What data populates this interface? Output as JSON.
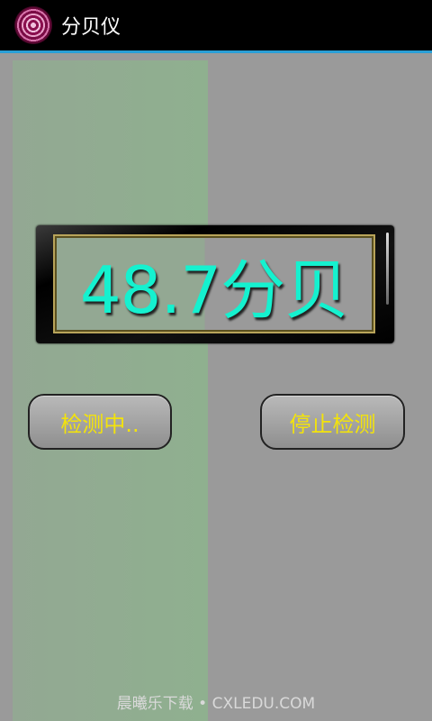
{
  "app": {
    "title": "分贝仪",
    "icon": "concentric-circles-icon"
  },
  "meter": {
    "reading": "48.7分贝"
  },
  "buttons": {
    "left_label": "检测中..",
    "right_label": "停止检测"
  },
  "watermark": "晨曦乐下载 • CXLEDU.COM",
  "colors": {
    "title_bar": "#000000",
    "accent": "#2a9fd6",
    "background": "#9a9a9a",
    "green_panel": "#8fb08f",
    "reading": "#15f1cf",
    "button_text": "#f3e30b"
  }
}
